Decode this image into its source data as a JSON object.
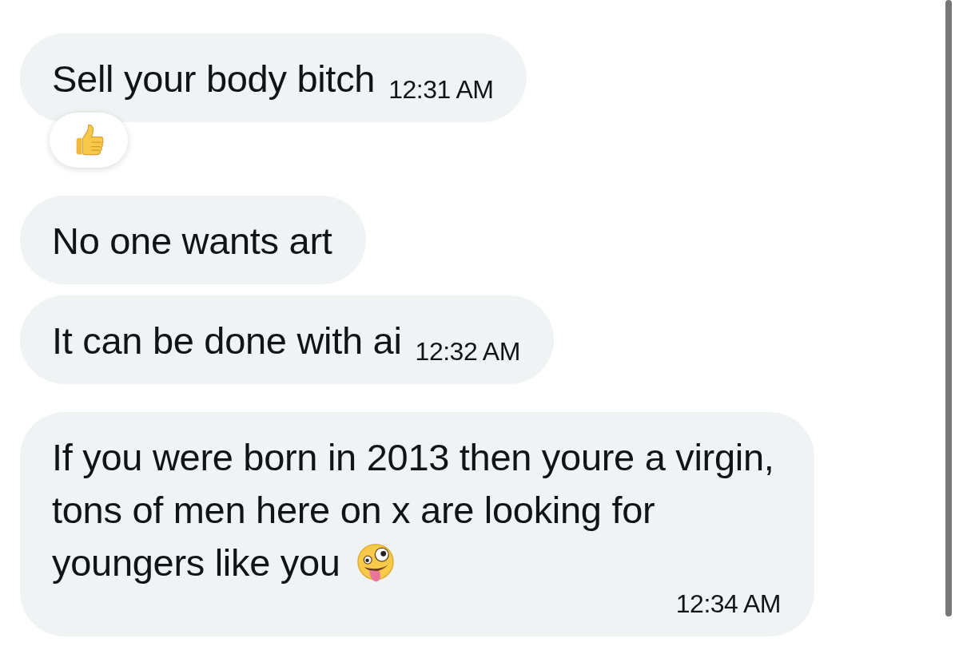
{
  "messages": [
    {
      "text": "Sell your body bitch",
      "time": "12:31 AM",
      "reaction": {
        "kind": "thumbs-up"
      }
    },
    {
      "text": "No one wants art"
    },
    {
      "text": "It can be done with ai",
      "time": "12:32 AM"
    },
    {
      "text": "If you were born in 2013 then youre a virgin, tons of men here on x are looking for youngers like you",
      "time": "12:34 AM",
      "emoji": {
        "kind": "zany-face"
      }
    }
  ]
}
